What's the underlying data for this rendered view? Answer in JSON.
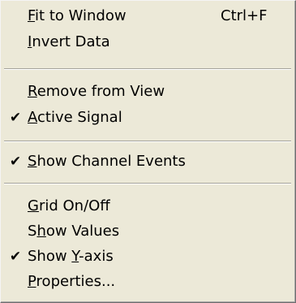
{
  "menu": {
    "items": [
      {
        "pre": "",
        "ul": "F",
        "post": "it to Window",
        "shortcut": "Ctrl+F",
        "checked": false
      },
      {
        "pre": "",
        "ul": "I",
        "post": "nvert Data",
        "shortcut": "",
        "checked": false
      },
      {
        "pre": "",
        "ul": "R",
        "post": "emove from View",
        "shortcut": "",
        "checked": false
      },
      {
        "pre": "",
        "ul": "A",
        "post": "ctive Signal",
        "shortcut": "",
        "checked": true
      },
      {
        "pre": "",
        "ul": "S",
        "post": "how Channel Events",
        "shortcut": "",
        "checked": true
      },
      {
        "pre": "",
        "ul": "G",
        "post": "rid On/Off",
        "shortcut": "",
        "checked": false
      },
      {
        "pre": "S",
        "ul": "h",
        "post": "ow Values",
        "shortcut": "",
        "checked": false
      },
      {
        "pre": "Show ",
        "ul": "Y",
        "post": "-axis",
        "shortcut": "",
        "checked": true
      },
      {
        "pre": "",
        "ul": "P",
        "post": "roperties...",
        "shortcut": "",
        "checked": false
      }
    ],
    "check_glyph": "✔"
  }
}
